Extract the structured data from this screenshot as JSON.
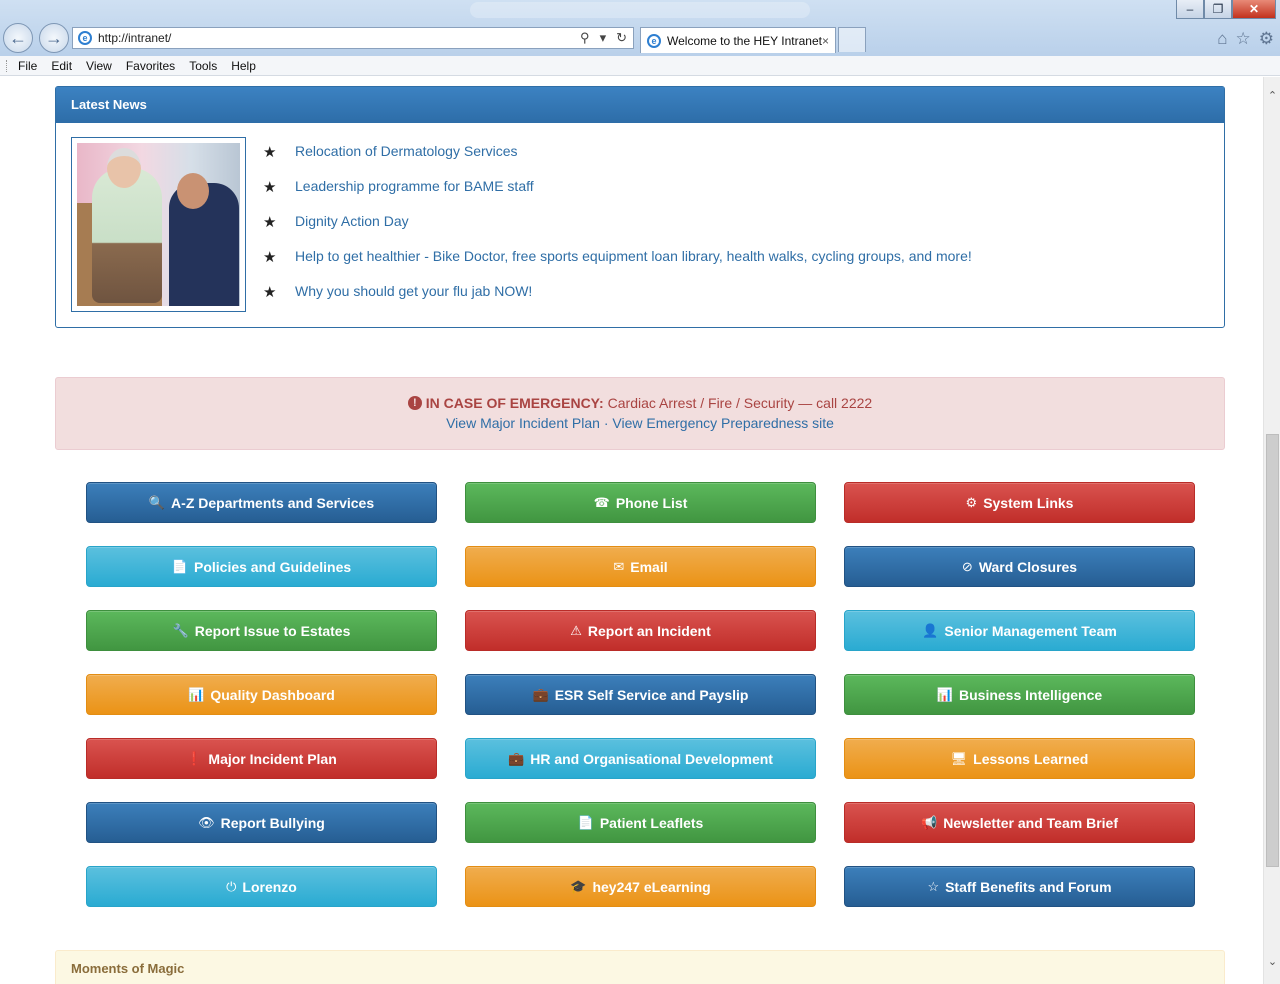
{
  "browser": {
    "url": "http://intranet/",
    "tab_title": "Welcome to the HEY Intranet",
    "tab_close": "×",
    "menu": [
      "File",
      "Edit",
      "View",
      "Favorites",
      "Tools",
      "Help"
    ],
    "window_controls": {
      "minimize": "–",
      "maximize": "❐",
      "close": "✕"
    },
    "icons": {
      "back": "arrow-left",
      "forward": "arrow-right",
      "home": "home",
      "favorites": "star",
      "settings": "gear"
    }
  },
  "latest_news": {
    "heading": "Latest News",
    "items": [
      "Relocation of Dermatology Services",
      "Leadership programme for BAME staff",
      "Dignity Action Day",
      "Help to get healthier - Bike Doctor, free sports equipment loan library, health walks, cycling groups, and more!",
      "Why you should get your flu jab NOW!"
    ]
  },
  "emergency": {
    "label": "IN CASE OF EMERGENCY:",
    "text": "Cardiac Arrest / Fire / Security — call 2222",
    "link1": "View Major Incident Plan",
    "separator": "·",
    "link2": "View Emergency Preparedness site"
  },
  "quick_links": [
    {
      "label": "A-Z Departments and Services",
      "icon": "🔍",
      "icon_name": "search-icon",
      "color": "blue"
    },
    {
      "label": "Phone List",
      "icon": "☎",
      "icon_name": "phone-icon",
      "color": "green"
    },
    {
      "label": "System Links",
      "icon": "⚙",
      "icon_name": "gear-icon",
      "color": "red"
    },
    {
      "label": "Policies and Guidelines",
      "icon": "📄",
      "icon_name": "documents-icon",
      "color": "cyan"
    },
    {
      "label": "Email",
      "icon": "✉",
      "icon_name": "envelope-icon",
      "color": "orange"
    },
    {
      "label": "Ward Closures",
      "icon": "⊘",
      "icon_name": "ban-icon",
      "color": "blue"
    },
    {
      "label": "Report Issue to Estates",
      "icon": "🔧",
      "icon_name": "wrench-icon",
      "color": "green"
    },
    {
      "label": "Report an Incident",
      "icon": "⚠",
      "icon_name": "warning-icon",
      "color": "red"
    },
    {
      "label": "Senior Management Team",
      "icon": "👤",
      "icon_name": "user-icon",
      "color": "cyan"
    },
    {
      "label": "Quality Dashboard",
      "icon": "📊",
      "icon_name": "bar-chart-icon",
      "color": "orange"
    },
    {
      "label": "ESR Self Service and Payslip",
      "icon": "💼",
      "icon_name": "folder-icon",
      "color": "blue"
    },
    {
      "label": "Business Intelligence",
      "icon": "📊",
      "icon_name": "bar-chart-icon",
      "color": "green"
    },
    {
      "label": "Major Incident Plan",
      "icon": "❗",
      "icon_name": "exclamation-icon",
      "color": "red"
    },
    {
      "label": "HR and Organisational Development",
      "icon": "💼",
      "icon_name": "briefcase-icon",
      "color": "cyan"
    },
    {
      "label": "Lessons Learned",
      "icon": "🖥",
      "icon_name": "blackboard-icon",
      "color": "orange"
    },
    {
      "label": "Report Bullying",
      "icon": "👁",
      "icon_name": "eye-icon",
      "color": "blue"
    },
    {
      "label": "Patient Leaflets",
      "icon": "📄",
      "icon_name": "file-icon",
      "color": "green"
    },
    {
      "label": "Newsletter and Team Brief",
      "icon": "📢",
      "icon_name": "bullhorn-icon",
      "color": "red"
    },
    {
      "label": "Lorenzo",
      "icon": "⏻",
      "icon_name": "power-icon",
      "color": "cyan"
    },
    {
      "label": "hey247 eLearning",
      "icon": "🎓",
      "icon_name": "education-icon",
      "color": "orange"
    },
    {
      "label": "Staff Benefits and Forum",
      "icon": "☆",
      "icon_name": "star-icon",
      "color": "blue"
    }
  ],
  "moments_of_magic": {
    "heading": "Moments of Magic"
  },
  "colors": {
    "blue": "#2d6da8",
    "green": "#5cb85c",
    "red": "#d9534f",
    "cyan": "#5bc0de",
    "orange": "#f0ad4e",
    "alert_bg": "#f2dede",
    "alert_text": "#a94442",
    "link": "#2f6ea6"
  }
}
